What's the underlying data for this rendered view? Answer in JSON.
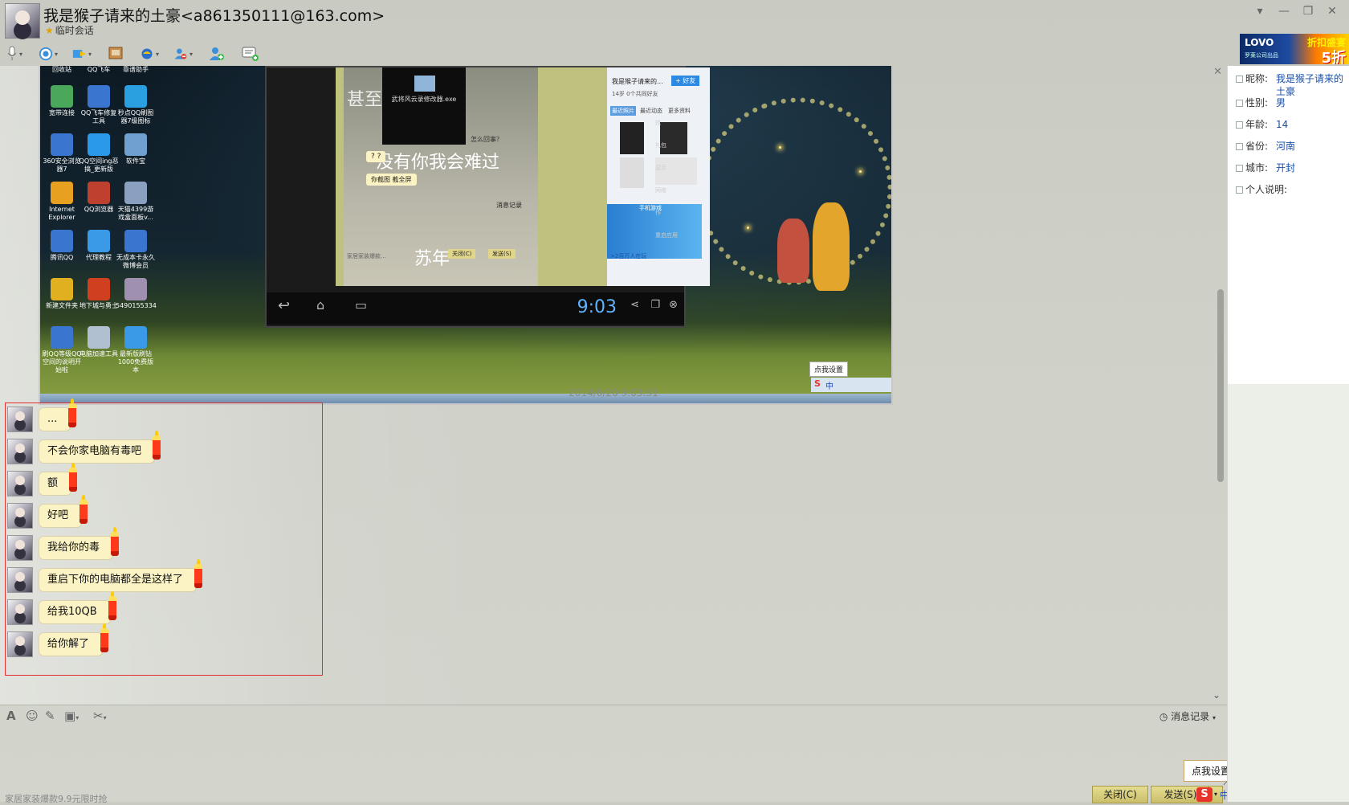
{
  "title": {
    "contact": "我是猴子请来的土豪<a861350111@163.com>",
    "session_type": "临时会话"
  },
  "window_controls": [
    "▾",
    "—",
    "❐",
    "✕"
  ],
  "toolbar": {
    "icons": [
      "microphone-icon",
      "video-icon",
      "file-transfer-icon",
      "screen-share-icon",
      "remote-assist-icon",
      "block-user-icon",
      "add-friend-icon",
      "group-chat-icon"
    ]
  },
  "ad": {
    "brand": "LOVO",
    "sub": "罗莱公司出品",
    "promo": "折扣盛宴",
    "discount": "5折"
  },
  "screenshot": {
    "timestamp": "2014/6/20 9:03:31",
    "desktop_icons": [
      {
        "label": "回收站"
      },
      {
        "label": "QQ飞车"
      },
      {
        "label": "靠谱助手"
      },
      {
        "label": "宽带连接"
      },
      {
        "label": "QQ飞车修复工具"
      },
      {
        "label": "秒点QQ刷图器7级图标"
      },
      {
        "label": "360安全浏览器7"
      },
      {
        "label": "QQ空间ing恶搞_更新版"
      },
      {
        "label": "软件宝"
      },
      {
        "label": "Internet Explorer"
      },
      {
        "label": "QQ浏览器"
      },
      {
        "label": "天猫4399游戏盒面板v..."
      },
      {
        "label": "腾讯QQ"
      },
      {
        "label": "代理教程"
      },
      {
        "label": "无成本卡永久微博会员"
      },
      {
        "label": "新建文件夹"
      },
      {
        "label": "地下城与勇士"
      },
      {
        "label": "5490155334"
      },
      {
        "label": "刷QQ等级QQ空间的说明开始啦"
      },
      {
        "label": "电脑加速工具"
      },
      {
        "label": "最新版刷钻1000免费版本"
      }
    ],
    "inner_chat": {
      "msgs": [
        "? ?",
        "你截图 截全屏"
      ],
      "overlay_text_1": "甚至",
      "overlay_text_2": "没有你我会难过",
      "overlay_text_3": "苏年",
      "tooltip": "武将风云录修改器.exe",
      "question": "怎么回事？",
      "history": "消息记录",
      "close": "关闭(C)",
      "send": "发送(S)",
      "footer": "家居家装爆款..."
    },
    "inner_profile": {
      "name": "我是猴子请来的...",
      "add_friend": "+ 好友",
      "age_info": "14岁 0个共同好友",
      "tabs": [
        "最近照片",
        "最近动态",
        "更多资料"
      ],
      "game": "手机游戏",
      "online": ">2百万人在玩"
    },
    "inner_time": "9:03",
    "inner_side": [
      "找",
      "礼包",
      "显示",
      "网络",
      "作",
      "重启应用"
    ],
    "tray_tooltip": "点我设置",
    "tray_ime": "中"
  },
  "messages": [
    {
      "text": "..."
    },
    {
      "text": "不会你家电脑有毒吧"
    },
    {
      "text": "额"
    },
    {
      "text": "好吧"
    },
    {
      "text": "我给你的毒"
    },
    {
      "text": "重启下你的电脑都全是这样了"
    },
    {
      "text": "给我10QB"
    },
    {
      "text": "给你解了"
    }
  ],
  "input_toolbar": {
    "icons": [
      "font-icon",
      "emoji-icon",
      "edit-icon",
      "image-icon",
      "scissors-icon"
    ],
    "history": "消息记录"
  },
  "footer": {
    "ad": "家居家装爆款9.9元限时抢",
    "close": "关闭(C)",
    "send": "发送(S)",
    "tooltip": "点我设置",
    "ime_label": "中"
  },
  "profile": [
    {
      "label": "昵称:",
      "value": "我是猴子请来的土豪"
    },
    {
      "label": "性别:",
      "value": "男"
    },
    {
      "label": "年龄:",
      "value": "14"
    },
    {
      "label": "省份:",
      "value": "河南"
    },
    {
      "label": "城市:",
      "value": "开封"
    },
    {
      "label": "个人说明:",
      "value": ""
    }
  ],
  "colors": {
    "bubble": "#fbf3c4",
    "highlight_box": "#e03030",
    "link_blue": "#1a4fa8",
    "button": "#d9cf7d"
  }
}
